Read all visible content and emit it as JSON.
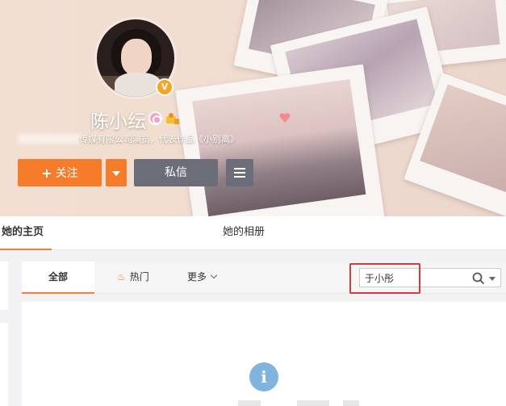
{
  "profile": {
    "name": "陈小纭",
    "bio": "传媒有限公司演员，代表作品《小别离》",
    "verified_badge": "V",
    "gender_icon": "female-icon",
    "level_icon": "level-icon"
  },
  "actions": {
    "follow_plus": "+",
    "follow_label": "关注",
    "message_label": "私信"
  },
  "tabs": [
    {
      "label": "她的主页",
      "active": true
    },
    {
      "label": "她的相册",
      "active": false
    }
  ],
  "filter": {
    "all_label": "全部",
    "hot_label": "热门",
    "more_label": "更多"
  },
  "search": {
    "value": "于小彤",
    "icon": "search-icon"
  },
  "colors": {
    "accent": "#f57c2a",
    "secondary_button": "#6b6e78",
    "highlight_border": "#d9393b",
    "info": "#7fb5dc"
  },
  "empty_state": {
    "icon": "info-icon",
    "glyph": "i"
  }
}
